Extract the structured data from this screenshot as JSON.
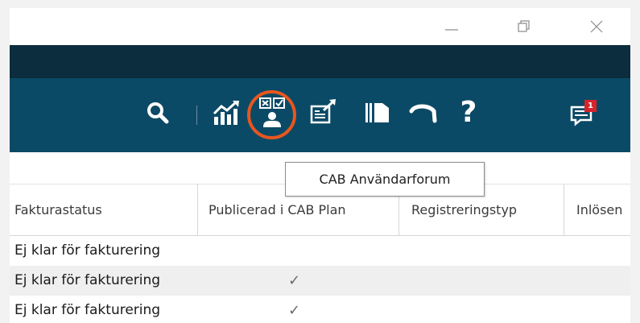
{
  "window": {
    "controls": {
      "minimize": "minimize-icon",
      "maximize": "restore-icon",
      "close": "close-icon"
    }
  },
  "toolbar": {
    "icons": [
      "search-icon",
      "statistics-chart-icon",
      "cab-user-forum-icon",
      "form-export-icon",
      "book-icon",
      "call-icon",
      "help-icon",
      "messages-icon"
    ],
    "notification_badge": "1",
    "help_glyph": "?",
    "highlight_color": "#e8561f",
    "background_color": "#0b4a66",
    "strip_color": "#0c2d3e"
  },
  "tooltip": {
    "text": "CAB Användarforum"
  },
  "table": {
    "columns": [
      "Fakturastatus",
      "Publicerad i CAB Plan",
      "Registreringstyp",
      "Inlösen"
    ],
    "rows": [
      {
        "status": "Ej klar för fakturering",
        "published": ""
      },
      {
        "status": "Ej klar för fakturering",
        "published": "✓"
      },
      {
        "status": "Ej klar för fakturering",
        "published": "✓"
      }
    ]
  }
}
